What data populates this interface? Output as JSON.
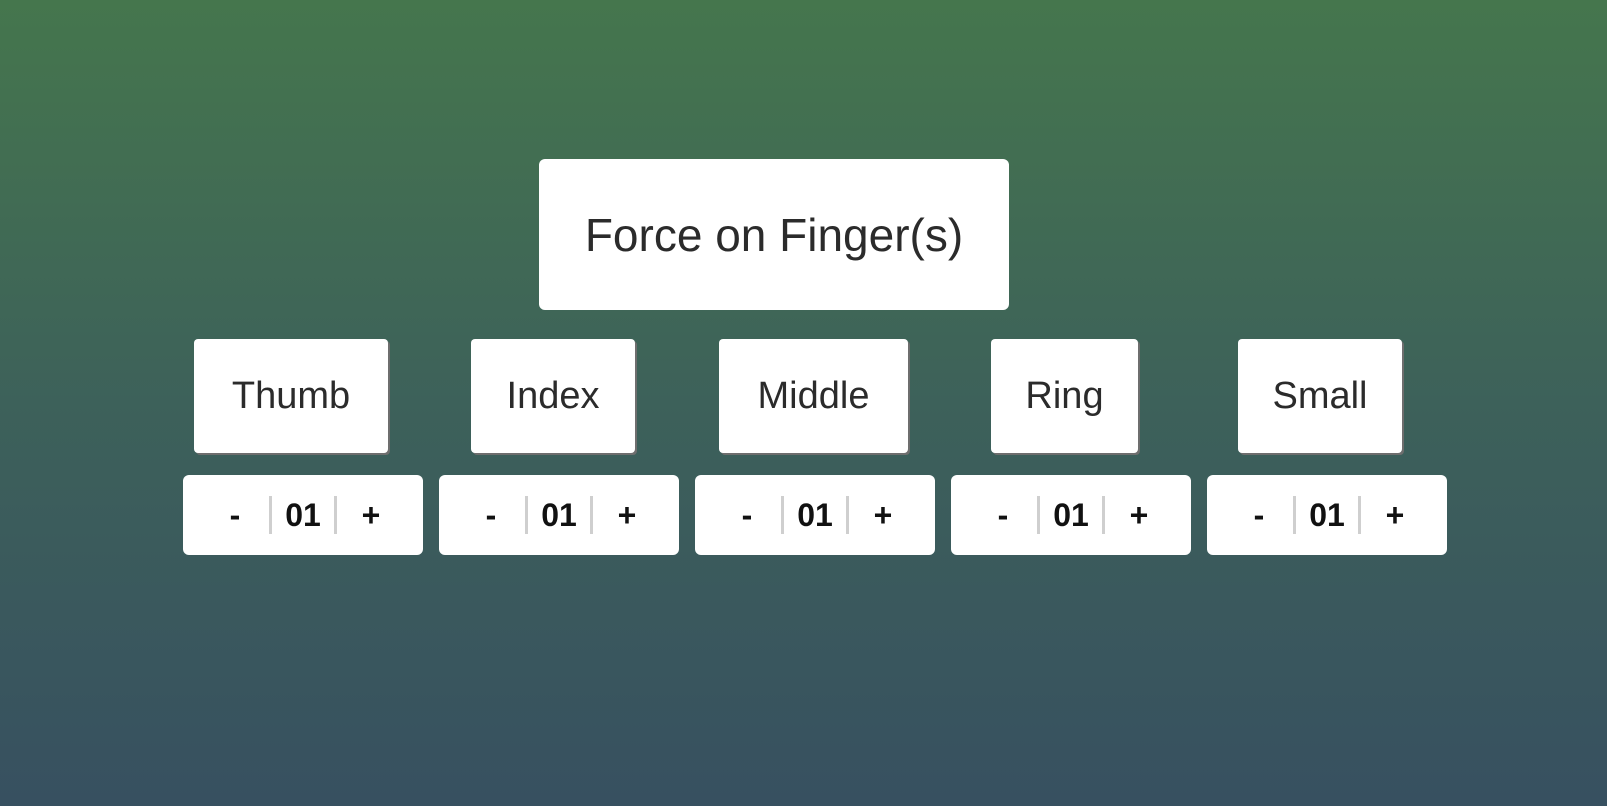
{
  "title": "Force on Finger(s)",
  "fingers": [
    {
      "label": "Thumb",
      "value": "01",
      "decrement": "-",
      "increment": "+"
    },
    {
      "label": "Index",
      "value": "01",
      "decrement": "-",
      "increment": "+"
    },
    {
      "label": "Middle",
      "value": "01",
      "decrement": "-",
      "increment": "+"
    },
    {
      "label": "Ring",
      "value": "01",
      "decrement": "-",
      "increment": "+"
    },
    {
      "label": "Small",
      "value": "01",
      "decrement": "-",
      "increment": "+"
    }
  ],
  "colors": {
    "background_top": "#45764d",
    "background_bottom": "#375060",
    "panel": "#ffffff",
    "text": "#2b2b2b",
    "divider": "#cfcfcf"
  }
}
